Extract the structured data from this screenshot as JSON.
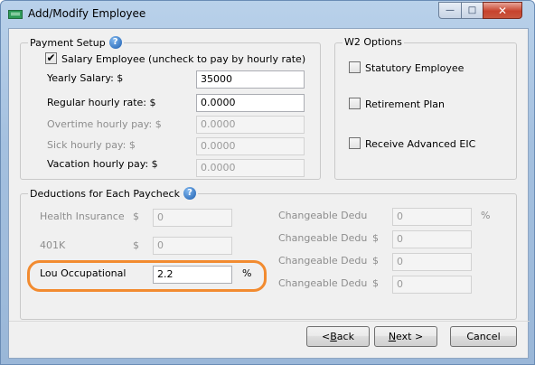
{
  "window": {
    "title": "Add/Modify Employee",
    "min_label": "—",
    "max_label": "□",
    "close_label": "✕"
  },
  "payment": {
    "legend": "Payment Setup",
    "help": "?",
    "salary_check_label": "Salary Employee (uncheck to pay by hourly rate)",
    "salary_checked": "✔",
    "rows": [
      {
        "label": "Yearly Salary: $",
        "value": "35000"
      },
      {
        "label": "Regular hourly rate: $",
        "value": "0.0000"
      },
      {
        "label": "Overtime hourly pay: $",
        "value": "0.0000"
      },
      {
        "label": "Sick hourly pay: $",
        "value": "0.0000"
      },
      {
        "label": "Vacation hourly pay: $",
        "value": "0.0000"
      }
    ]
  },
  "w2": {
    "legend": "W2 Options",
    "items": [
      {
        "label": "Statutory Employee"
      },
      {
        "label": "Retirement Plan"
      },
      {
        "label": "Receive Advanced EIC"
      }
    ]
  },
  "deductions": {
    "legend": "Deductions for Each Paycheck",
    "help": "?",
    "left": [
      {
        "label": "Health Insurance",
        "unit": "$",
        "value": "0"
      },
      {
        "label": "401K",
        "unit": "$",
        "value": "0"
      },
      {
        "label": "Lou Occupational",
        "unit": "%",
        "value": "2.2"
      }
    ],
    "right": [
      {
        "label": "Changeable Dedu",
        "unit": "%",
        "value": "0"
      },
      {
        "label": "Changeable Dedu",
        "unit": "$",
        "value": "0"
      },
      {
        "label": "Changeable Dedu",
        "unit": "$",
        "value": "0"
      },
      {
        "label": "Changeable Dedu",
        "unit": "$",
        "value": "0"
      }
    ]
  },
  "buttons": {
    "back_prefix": "< ",
    "back_u": "B",
    "back_rest": "ack",
    "next_u": "N",
    "next_rest": "ext >",
    "cancel": "Cancel"
  },
  "colors": {
    "highlight": "#f28b30",
    "help_icon": "#1e5fb0"
  }
}
